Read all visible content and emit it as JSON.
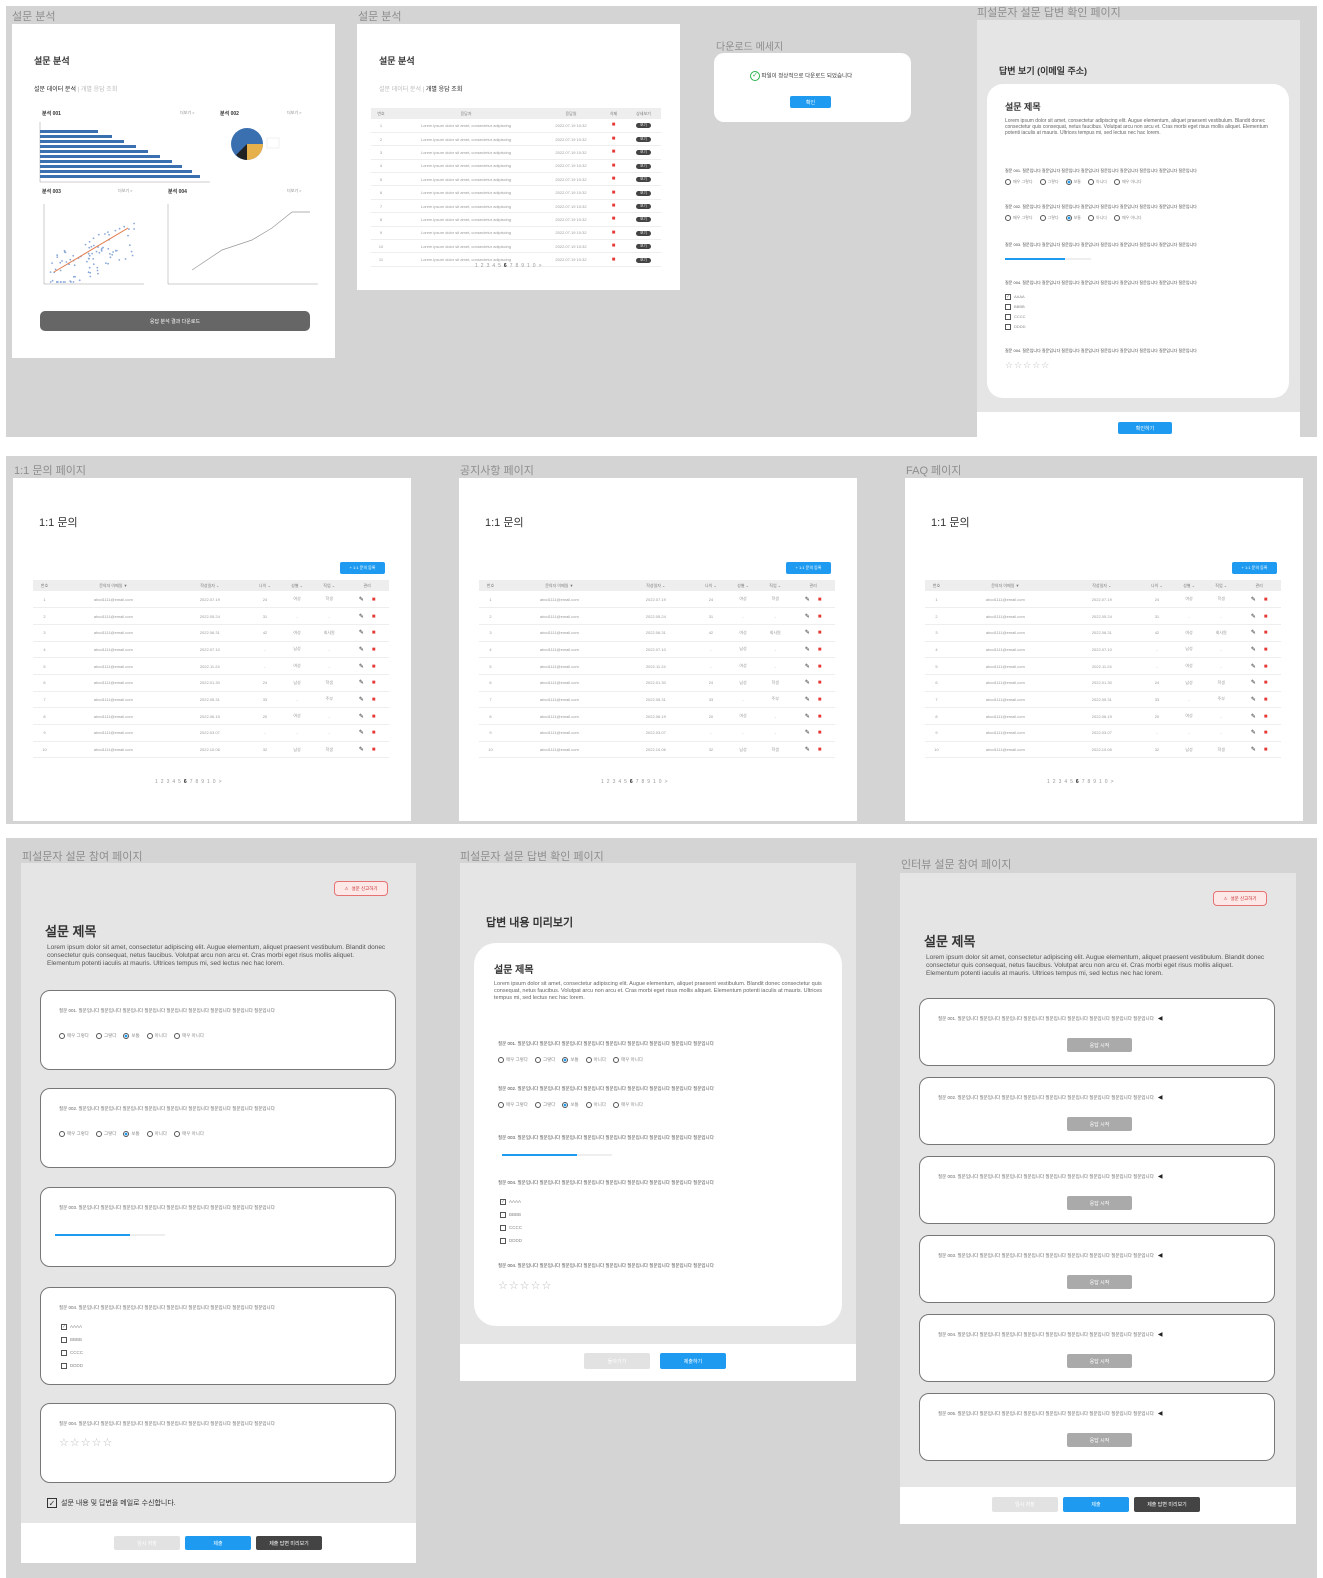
{
  "frames": {
    "analysis1": "설문 분석",
    "analysis2": "설문 분석",
    "download": "다운로드 메세지",
    "respondent_check_top": "피설문자 설문 답변 확인 페이지",
    "inquiry": "1:1 문의 페이지",
    "notice": "공지사항 페이지",
    "faq": "FAQ 페이지",
    "participate": "피설문자 설문 참여 페이지",
    "respondent_check": "피설문자 설문 답변 확인 페이지",
    "interview": "인터뷰 설문 참여 페이지"
  },
  "analysis": {
    "title": "설문 분석",
    "tab_active": "설문 데이터 분석",
    "tab_inactive": "개별 응답 조회",
    "charts": [
      {
        "label": "분석 001",
        "more": "더보기 >"
      },
      {
        "label": "분석 002",
        "more": "더보기 >"
      },
      {
        "label": "분석 003",
        "more": "더보기 >"
      },
      {
        "label": "분석 004",
        "more": "더보기 >"
      }
    ],
    "download_button": "응답 분석 결과 다운로드"
  },
  "analysis2": {
    "title": "설문 분석",
    "tab_inactive": "설문 데이터 분석",
    "tab_active": "개별 응답 조회",
    "headers": [
      "번호",
      "응답자",
      "응답일",
      "삭제",
      "상세보기"
    ],
    "rows": [
      [
        "1",
        "Lorem ipsum dolor sit amet, consectetur adipiscing",
        "2022.07.19 10:32"
      ],
      [
        "2",
        "Lorem ipsum dolor sit amet, consectetur adipiscing",
        "2022.07.19 10:32"
      ],
      [
        "3",
        "Lorem ipsum dolor sit amet, consectetur adipiscing",
        "2022.07.19 10:32"
      ],
      [
        "4",
        "Lorem ipsum dolor sit amet, consectetur adipiscing",
        "2022.07.19 10:32"
      ],
      [
        "5",
        "Lorem ipsum dolor sit amet, consectetur adipiscing",
        "2022.07.19 10:32"
      ],
      [
        "6",
        "Lorem ipsum dolor sit amet, consectetur adipiscing",
        "2022.07.19 10:32"
      ],
      [
        "7",
        "Lorem ipsum dolor sit amet, consectetur adipiscing",
        "2022.07.19 10:32"
      ],
      [
        "8",
        "Lorem ipsum dolor sit amet, consectetur adipiscing",
        "2022.07.19 10:32"
      ],
      [
        "9",
        "Lorem ipsum dolor sit amet, consectetur adipiscing",
        "2022.07.19 10:32"
      ],
      [
        "10",
        "Lorem ipsum dolor sit amet, consectetur adipiscing",
        "2022.07.19 10:32"
      ],
      [
        "11",
        "Lorem ipsum dolor sit amet, consectetur adipiscing",
        "2022.07.19 10:32"
      ]
    ],
    "view_label": "보기",
    "pagination": [
      "1",
      "2",
      "3",
      "4",
      "5",
      "6",
      "7",
      "8",
      "9",
      "10",
      ">"
    ]
  },
  "download": {
    "message": "파일이 정상적으로 다운로드 되었습니다",
    "confirm": "확인"
  },
  "answer_view": {
    "heading": "답변 보기 (이메일 주소)",
    "survey_title": "설문 제목",
    "desc": "Lorem ipsum dolor sit amet, consectetur adipiscing elit. Augue elementum, aliquet praesent vestibulum. Blandit donec consectetur quis consequat, netus faucibus. Volutpat arcu non arcu et. Cras morbi eget risus mollis aliquet. Elementum potenti iaculis at mauris. Ultrices tempus mi, sed lectus nec hac lorem.",
    "confirm": "확인하기"
  },
  "questions": {
    "q1": "질문 001. 질문입니다 질문입니다 질문입니다 질문입니다 질문입니다 질문입니다 질문입니다 질문입니다 질문입니다",
    "q2": "질문 002. 질문입니다 질문입니다 질문입니다 질문입니다 질문입니다 질문입니다 질문입니다 질문입니다 질문입니다",
    "q3": "질문 003. 질문입니다 질문입니다 질문입니다 질문입니다 질문입니다 질문입니다 질문입니다 질문입니다 질문입니다",
    "q4": "질문 004. 질문입니다 질문입니다 질문입니다 질문입니다 질문입니다 질문입니다 질문입니다 질문입니다 질문입니다",
    "q5": "질문 004. 질문입니다 질문입니다 질문입니다 질문입니다 질문입니다 질문입니다 질문입니다 질문입니다 질문입니다",
    "options": [
      "매우 그렇다",
      "그렇다",
      "보통",
      "아니다",
      "매우 아니다"
    ],
    "checks": [
      "AAAA",
      "BBBB",
      "CCCC",
      "DDDD"
    ],
    "stars": "☆☆☆☆☆"
  },
  "inquiry_pages": [
    {
      "title": "1:1 문의",
      "register": "+ 1:1 문의 등록"
    },
    {
      "title": "1:1 문의",
      "register": "+ 1:1 문의 등록"
    },
    {
      "title": "1:1 문의",
      "register": "+ 1:1 문의 등록"
    }
  ],
  "inquiry_table": {
    "headers": [
      "번호",
      "문의자 이메일 ▼",
      "작성일자 ⌄",
      "나이 ⌄",
      "성별 ⌄",
      "직업 ⌄",
      "관리"
    ],
    "rows": [
      [
        "1",
        "abcd1111@email.com",
        "2022.07.19",
        "24",
        "여성",
        "학생"
      ],
      [
        "2",
        "abcd1111@email.com",
        "2022.05.24",
        "31",
        "-",
        "-"
      ],
      [
        "3",
        "abcd1111@email.com",
        "2022.06.31",
        "42",
        "여성",
        "회사원"
      ],
      [
        "4",
        "abcd1111@email.com",
        "2022.07.10",
        "-",
        "남성",
        "-"
      ],
      [
        "5",
        "abcd1111@email.com",
        "2022.11.24",
        "-",
        "여성",
        "-"
      ],
      [
        "6",
        "abcd1111@email.com",
        "2022.01.30",
        "24",
        "남성",
        "학생"
      ],
      [
        "7",
        "abcd1111@email.com",
        "2022.05.31",
        "33",
        "-",
        "주부"
      ],
      [
        "8",
        "abcd1111@email.com",
        "2022.06.19",
        "20",
        "여성",
        "-"
      ],
      [
        "9",
        "abcd1111@email.com",
        "2022.03.07",
        "-",
        "-",
        "-"
      ],
      [
        "10",
        "abcd1111@email.com",
        "2022.10.06",
        "32",
        "남성",
        "학생"
      ]
    ],
    "pagination": [
      "1",
      "2",
      "3",
      "4",
      "5",
      "6",
      "7",
      "8",
      "9",
      "10",
      ">"
    ]
  },
  "participate": {
    "report": "설문 신고하기",
    "title": "설문 제목",
    "desc": "Lorem ipsum dolor sit amet, consectetur adipiscing elit. Augue elementum, aliquet praesent vestibulum. Blandit donec consectetur quis consequat, netus faucibus. Volutpat arcu non arcu et. Cras morbi eget risus mollis aliquet. Elementum potenti iaculis at mauris. Ultrices tempus mi, sed lectus nec hac lorem.",
    "email_consent": "설문 내용 및 답변을 메일로 수신합니다.",
    "temp_save": "임시 저장",
    "submit": "제출",
    "preview": "제출 답변 미리보기"
  },
  "preview": {
    "heading": "답변 내용 미리보기",
    "survey_title": "설문 제목",
    "desc": "Lorem ipsum dolor sit amet, consectetur adipiscing elit. Augue elementum, aliquet praesent vestibulum. Blandit donec consectetur quis consequat, netus faucibus. Volutpat arcu non arcu et. Cras morbi eget risus mollis aliquet. Elementum potenti iaculis at mauris. Ultrices tempus mi, sed lectus nec hac lorem.",
    "back": "돌아가기",
    "submit": "제출하기"
  },
  "interview": {
    "report": "설문 신고하기",
    "title": "설문 제목",
    "desc": "Lorem ipsum dolor sit amet, consectetur adipiscing elit. Augue elementum, aliquet praesent vestibulum. Blandit donec consectetur quis consequat, netus faucibus. Volutpat arcu non arcu et. Cras morbi eget risus mollis aliquet. Elementum potenti iaculis at mauris. Ultrices tempus mi, sed lectus nec hac lorem.",
    "questions": [
      "질문 001. 질문입니다 질문입니다 질문입니다 질문입니다 질문입니다 질문입니다 질문입니다 질문입니다 질문입니다",
      "질문 002. 질문입니다 질문입니다 질문입니다 질문입니다 질문입니다 질문입니다 질문입니다 질문입니다 질문입니다",
      "질문 003. 질문입니다 질문입니다 질문입니다 질문입니다 질문입니다 질문입니다 질문입니다 질문입니다 질문입니다",
      "질문 003. 질문입니다 질문입니다 질문입니다 질문입니다 질문입니다 질문입니다 질문입니다 질문입니다 질문입니다",
      "질문 004. 질문입니다 질문입니다 질문입니다 질문입니다 질문입니다 질문입니다 질문입니다 질문입니다 질문입니다",
      "질문 005. 질문입니다 질문입니다 질문입니다 질문입니다 질문입니다 질문입니다 질문입니다 질문입니다 질문입니다"
    ],
    "answer_start": "응답 시작",
    "temp_save": "임시 저장",
    "submit": "제출",
    "preview": "제출 답변 미리보기"
  },
  "colors": {
    "accent": "#1e9bf0",
    "danger": "#e53935",
    "dark": "#444444",
    "band": "#d4d4d4"
  }
}
